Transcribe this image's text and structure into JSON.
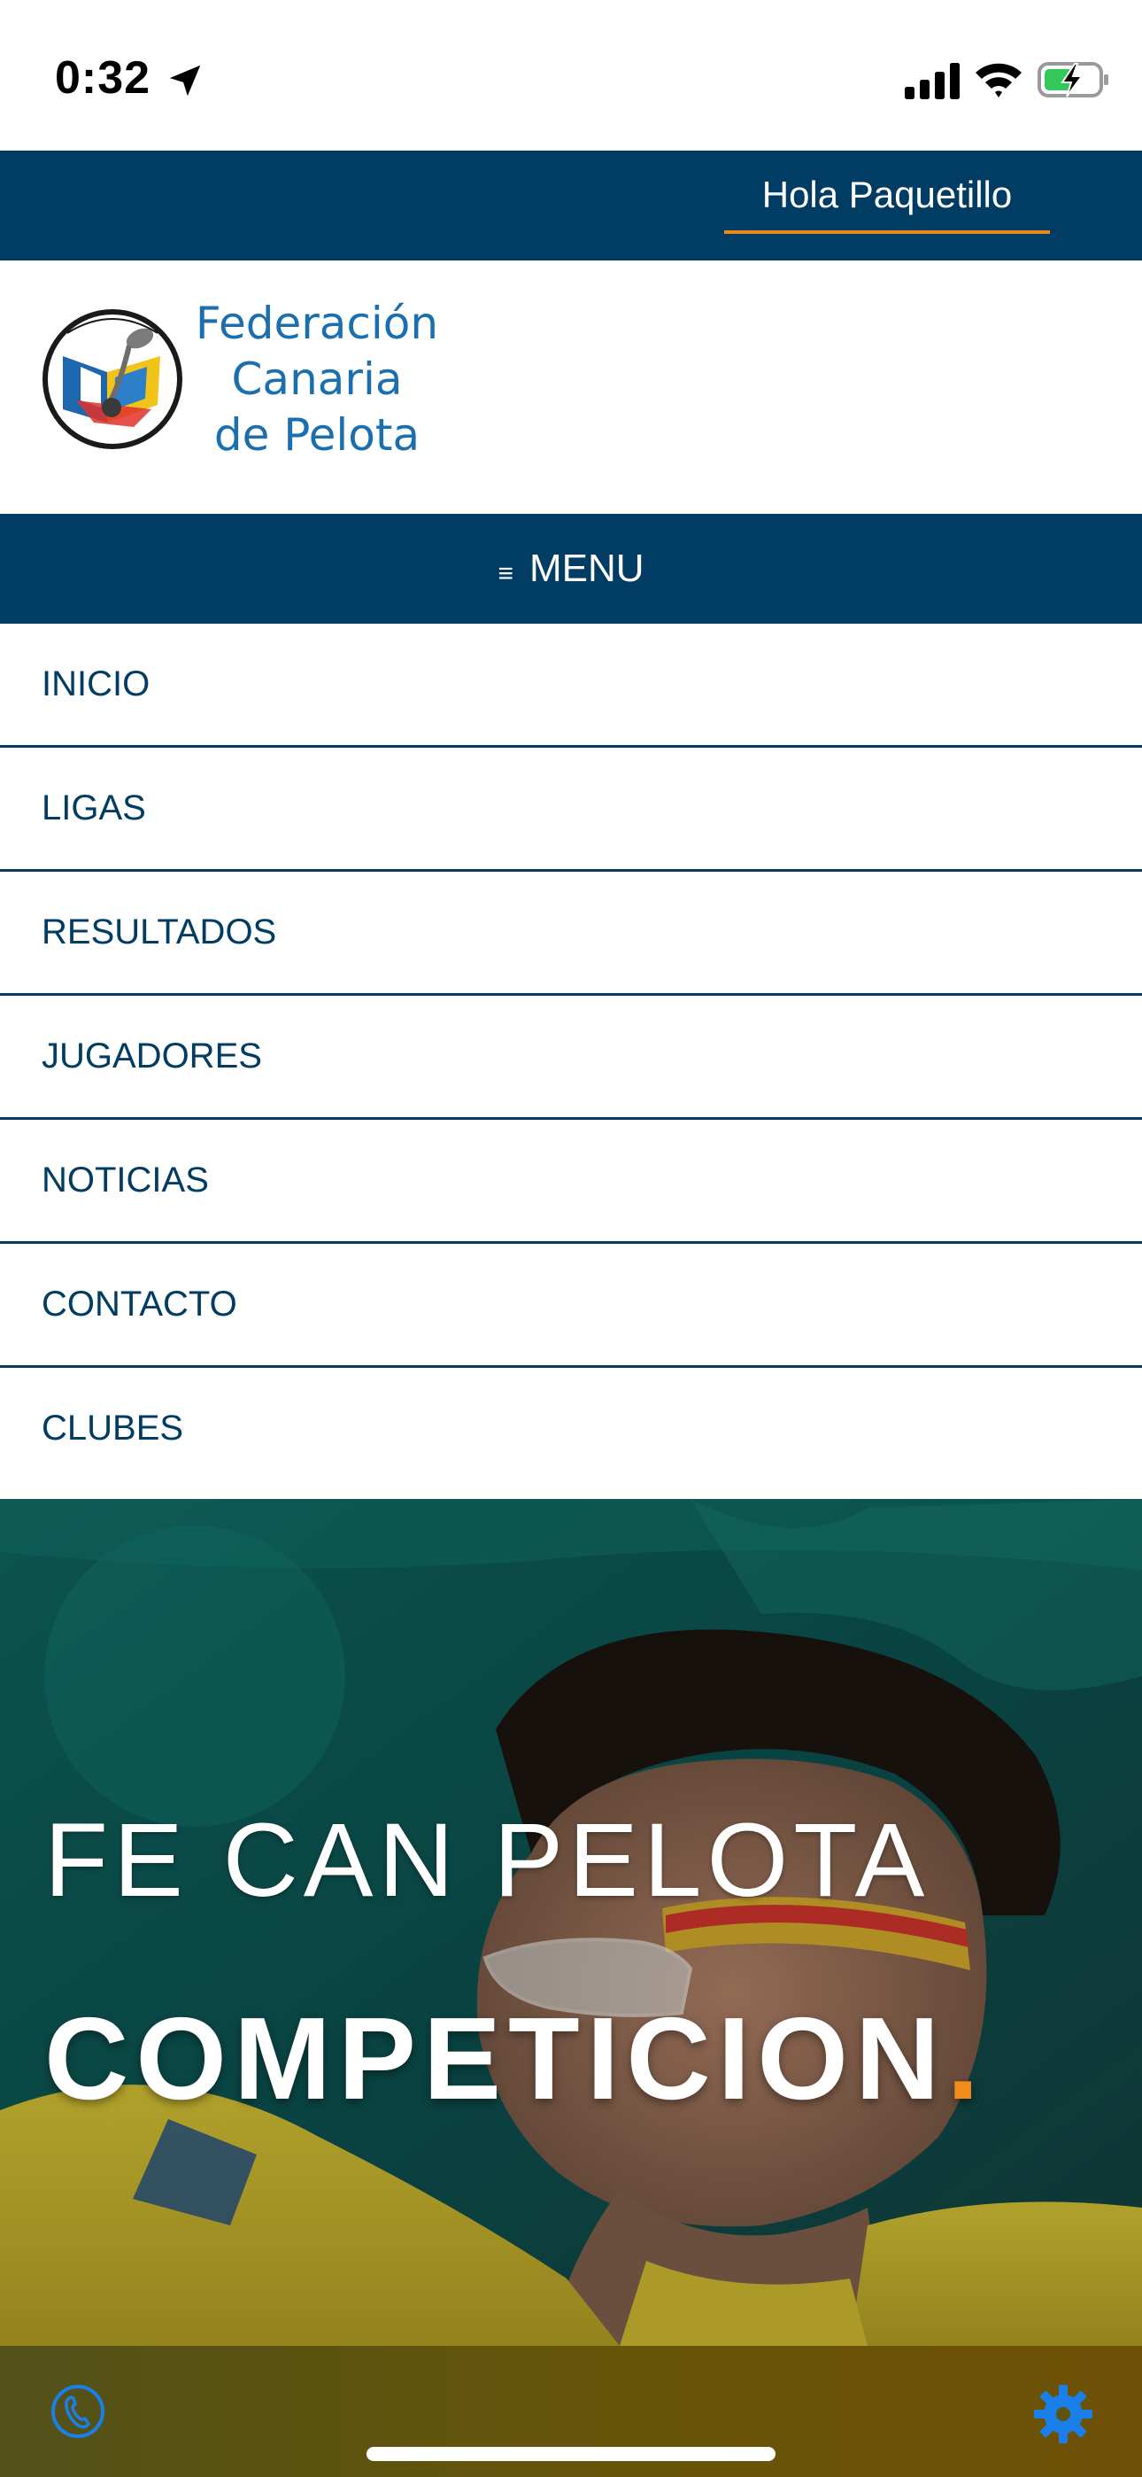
{
  "status_bar": {
    "time": "0:32",
    "icons": [
      "location-arrow-icon",
      "signal-bars-icon",
      "wifi-icon",
      "battery-charging-icon"
    ]
  },
  "header": {
    "greeting": "Hola Paquetillo"
  },
  "logo": {
    "line1": "Federación",
    "line2": "Canaria",
    "line3": "de Pelota"
  },
  "menu": {
    "label": "MENU",
    "glyph": "≡",
    "items": [
      {
        "label": "INICIO"
      },
      {
        "label": "LIGAS"
      },
      {
        "label": "RESULTADOS"
      },
      {
        "label": "JUGADORES"
      },
      {
        "label": "NOTICIAS"
      },
      {
        "label": "CONTACTO"
      },
      {
        "label": "CLUBES"
      }
    ]
  },
  "hero": {
    "subtitle": "FE CAN PELOTA",
    "title": "COMPETICION",
    "title_dot": "."
  },
  "bottom_bar": {
    "icons": [
      "phone-icon",
      "settings-gear-icon"
    ]
  },
  "colors": {
    "primary": "#003c63",
    "accent": "#e98a1f",
    "logo_text": "#1b6fae",
    "icon_blue": "#1a7fe8"
  }
}
